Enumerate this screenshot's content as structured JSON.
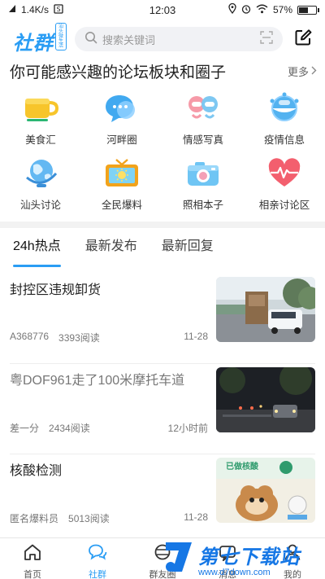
{
  "status_bar": {
    "speed": "1.4K/s",
    "time": "12:03",
    "battery": "57%",
    "battery_level": 0.57
  },
  "header": {
    "logo": "社群",
    "logo_mini": "汕头微生活",
    "search_placeholder": "搜索关键词"
  },
  "section": {
    "title": "你可能感兴趣的论坛板块和圈子",
    "more": "更多"
  },
  "categories": [
    {
      "label": "美食汇",
      "icon": "cup-icon"
    },
    {
      "label": "河畔圈",
      "icon": "chat-bubble-icon"
    },
    {
      "label": "情感写真",
      "icon": "couple-icon"
    },
    {
      "label": "疫情信息",
      "icon": "virus-icon"
    },
    {
      "label": "汕头讨论",
      "icon": "globe-icon"
    },
    {
      "label": "全民爆料",
      "icon": "tv-icon"
    },
    {
      "label": "照相本子",
      "icon": "camera-icon"
    },
    {
      "label": "相亲讨论区",
      "icon": "heart-pulse-icon"
    }
  ],
  "tabs": [
    {
      "label": "24h热点",
      "active": true
    },
    {
      "label": "最新发布",
      "active": false
    },
    {
      "label": "最新回复",
      "active": false
    }
  ],
  "posts": [
    {
      "title": "封控区违规卸货",
      "author": "A368776",
      "views": "3393阅读",
      "time": "11-28",
      "read": false
    },
    {
      "title": "粤DOF961走了100米摩托车道",
      "author": "差一分",
      "views": "2434阅读",
      "time": "12小时前",
      "read": true
    },
    {
      "title": "核酸检测",
      "author": "匿名爆料员",
      "views": "5013阅读",
      "time": "11-28",
      "read": false
    }
  ],
  "nav": [
    {
      "label": "首页",
      "icon": "home-icon",
      "active": false
    },
    {
      "label": "社群",
      "icon": "community-icon",
      "active": true
    },
    {
      "label": "群友圈",
      "icon": "friends-circle-icon",
      "active": false
    },
    {
      "label": "消息",
      "icon": "message-icon",
      "active": false
    },
    {
      "label": "我的",
      "icon": "user-icon",
      "active": false
    }
  ],
  "watermark": {
    "title": "第七下载站",
    "url": "www.d7down.com"
  },
  "colors": {
    "accent": "#2a9df4",
    "watermark": "#1677e5"
  }
}
